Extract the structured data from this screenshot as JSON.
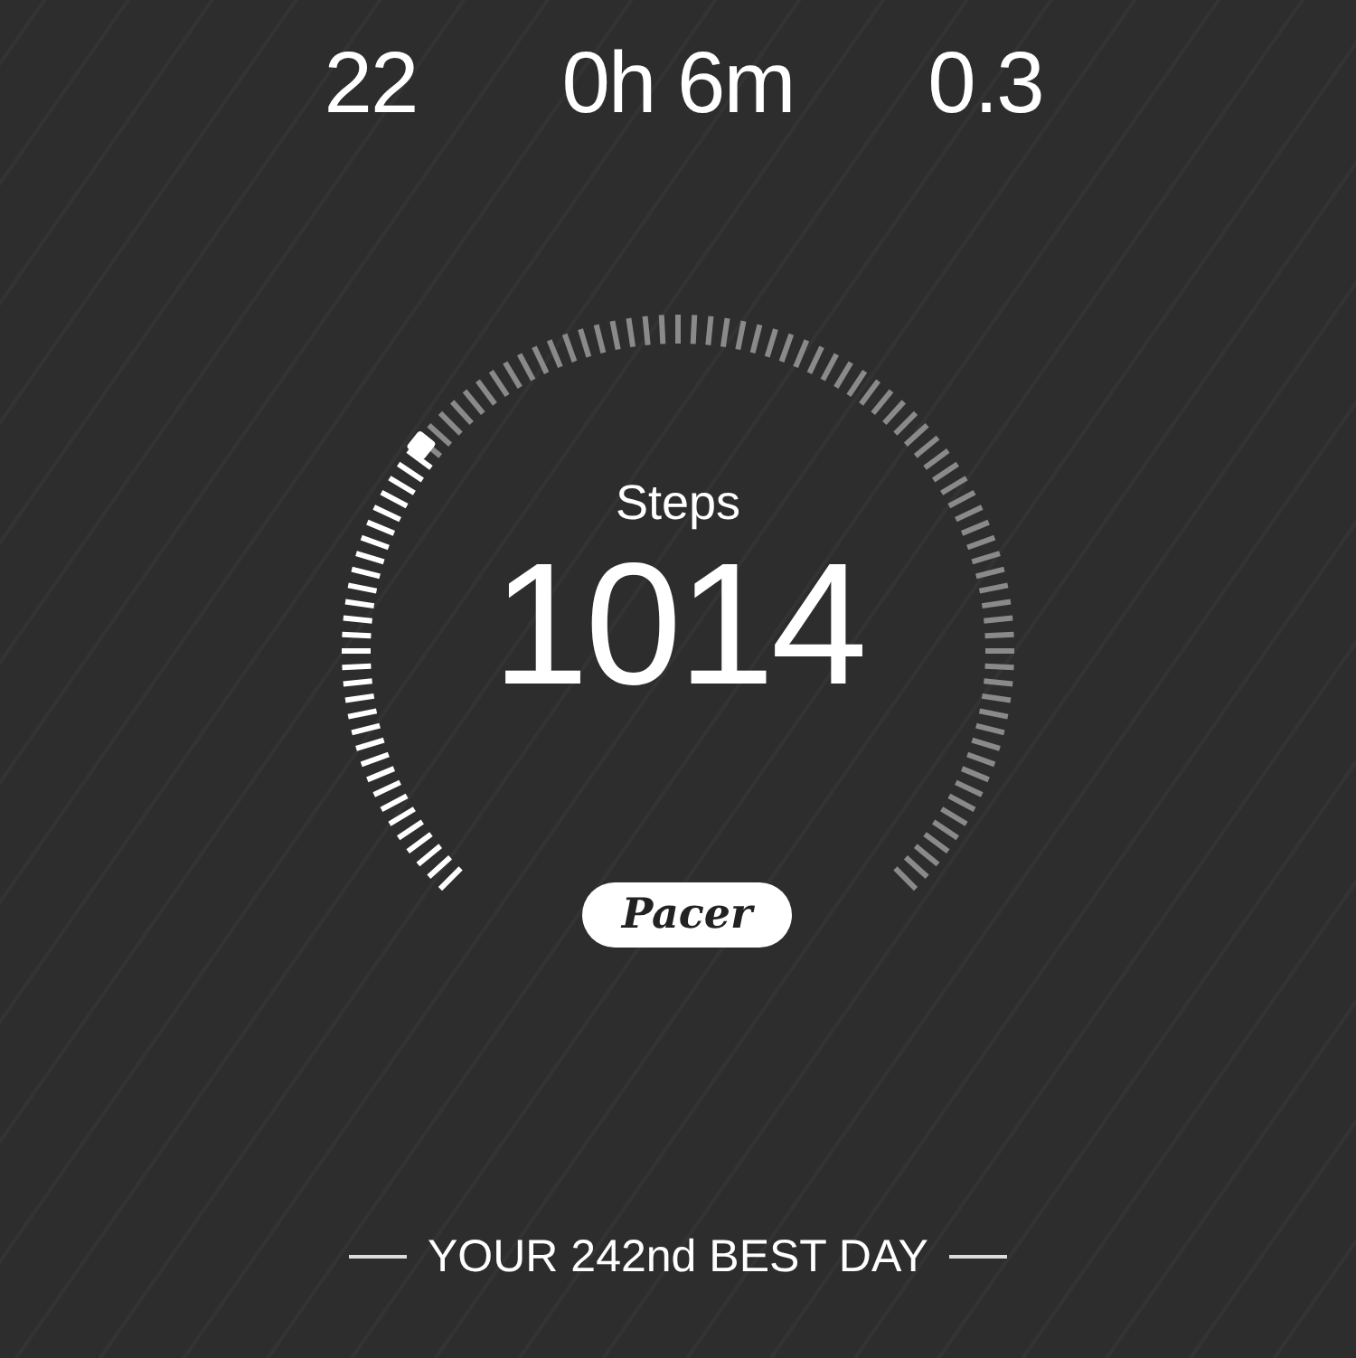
{
  "stats": [
    {
      "value": "22"
    },
    {
      "value": "0h 6m"
    },
    {
      "value": "0.3"
    }
  ],
  "gauge": {
    "label": "Steps",
    "value": "1014"
  },
  "badge": {
    "text": "Pacer"
  },
  "rank": {
    "text": "YOUR 242nd BEST DAY"
  }
}
